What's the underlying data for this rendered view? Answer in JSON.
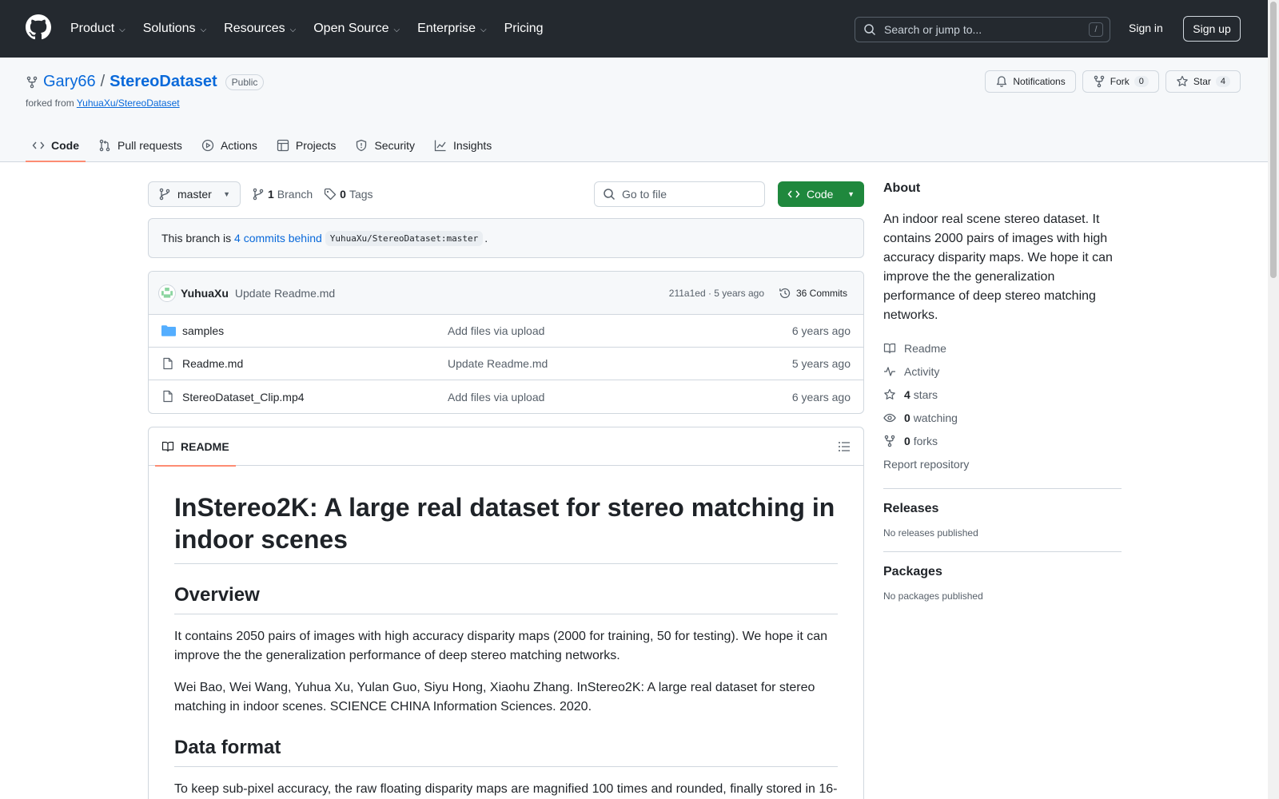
{
  "header": {
    "nav": [
      "Product",
      "Solutions",
      "Resources",
      "Open Source",
      "Enterprise",
      "Pricing"
    ],
    "search_placeholder": "Search or jump to...",
    "slash": "/",
    "signin": "Sign in",
    "signup": "Sign up"
  },
  "repo": {
    "owner": "Gary66",
    "sep": "/",
    "name": "StereoDataset",
    "visibility": "Public",
    "forked_prefix": "forked from",
    "forked_from": "YuhuaXu/StereoDataset",
    "notifications": "Notifications",
    "fork_label": "Fork",
    "fork_count": "0",
    "star_label": "Star",
    "star_count": "4",
    "tabs": [
      "Code",
      "Pull requests",
      "Actions",
      "Projects",
      "Security",
      "Insights"
    ]
  },
  "toolbar": {
    "branch": "master",
    "branch_count": "1",
    "branch_label": "Branch",
    "tag_count": "0",
    "tag_label": "Tags",
    "goto_placeholder": "Go to file",
    "code_button": "Code"
  },
  "behind": {
    "prefix": "This branch is",
    "link": "4 commits behind",
    "ref": "YuhuaXu/StereoDataset:master",
    "suffix": "."
  },
  "commit": {
    "author": "YuhuaXu",
    "message": "Update Readme.md",
    "meta": "211a1ed · 5 years ago",
    "commits": "36 Commits"
  },
  "files": [
    {
      "name": "samples",
      "type": "folder",
      "message": "Add files via upload",
      "date": "6 years ago"
    },
    {
      "name": "Readme.md",
      "type": "file",
      "message": "Update Readme.md",
      "date": "5 years ago"
    },
    {
      "name": "StereoDataset_Clip.mp4",
      "type": "file",
      "message": "Add files via upload",
      "date": "6 years ago"
    }
  ],
  "readme": {
    "tab": "README",
    "h1": "InStereo2K: A large real dataset for stereo matching in indoor scenes",
    "h2_overview": "Overview",
    "p1": "It contains 2050 pairs of images with high accuracy disparity maps (2000 for training, 50 for testing). We hope it can improve the the generalization performance of deep stereo matching networks.",
    "p2": "Wei Bao, Wei Wang, Yuhua Xu, Yulan Guo, Siyu Hong, Xiaohu Zhang. InStereo2K: A large real dataset for stereo matching in indoor scenes. SCIENCE CHINA Information Sciences. 2020.",
    "h2_format": "Data format",
    "p3": "To keep sub-pixel accuracy, the raw floating disparity maps are magnified 100 times and rounded, finally stored in 16-"
  },
  "sidebar": {
    "about_title": "About",
    "about": "An indoor real scene stereo dataset. It contains 2000 pairs of images with high accuracy disparity maps. We hope it can improve the the generalization performance of deep stereo matching networks.",
    "readme": "Readme",
    "activity": "Activity",
    "stars_count": "4",
    "stars_label": "stars",
    "watching_count": "0",
    "watching_label": "watching",
    "forks_count": "0",
    "forks_label": "forks",
    "report": "Report repository",
    "releases_title": "Releases",
    "releases_none": "No releases published",
    "packages_title": "Packages",
    "packages_none": "No packages published"
  },
  "colors": {
    "header_bg": "#24292f",
    "link": "#0969da",
    "code_green": "#1f883d",
    "tab_underline": "#fd8c73"
  }
}
